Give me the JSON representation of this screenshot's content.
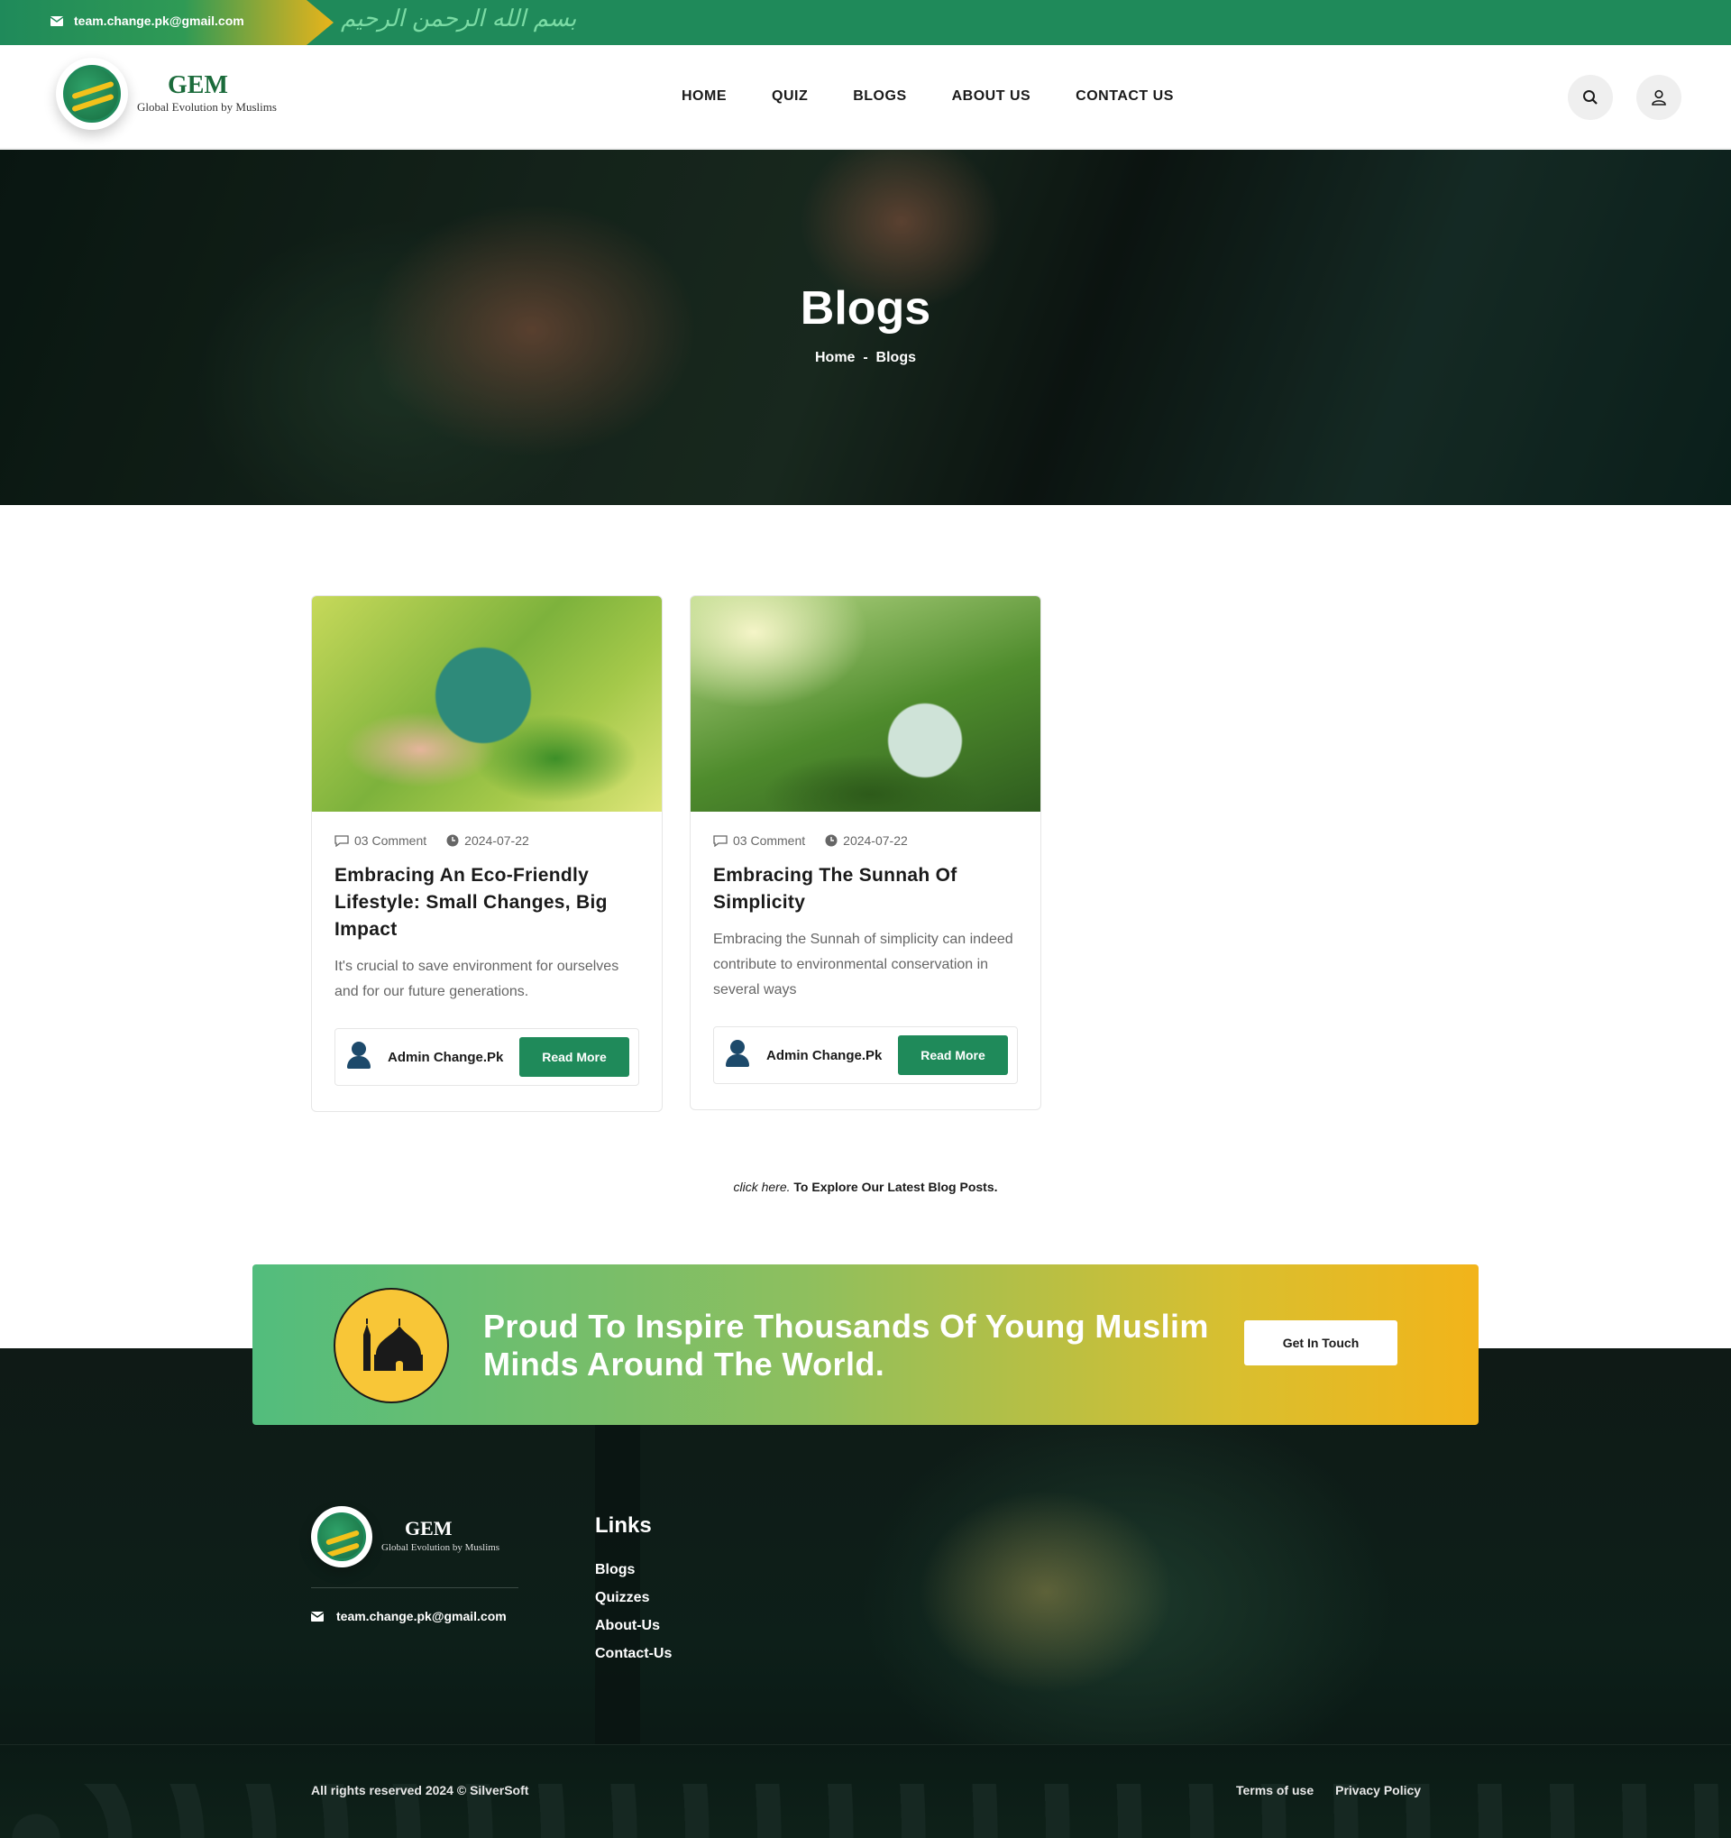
{
  "topbar": {
    "email": "team.change.pk@gmail.com",
    "bismillah": "بسم الله الرحمن الرحيم"
  },
  "brand": {
    "name": "GEM",
    "tagline": "Global Evolution by Muslims"
  },
  "nav": {
    "items": [
      "HOME",
      "QUIZ",
      "BLOGS",
      "ABOUT US",
      "CONTACT US"
    ]
  },
  "header_icons": [
    "search-icon",
    "user-icon"
  ],
  "hero": {
    "title": "Blogs",
    "breadcrumb_home": "Home",
    "breadcrumb_sep": "-",
    "breadcrumb_current": "Blogs"
  },
  "posts": [
    {
      "comments": "03 Comment",
      "date": "2024-07-22",
      "title": "Embracing An Eco-Friendly Lifestyle: Small Changes, Big Impact",
      "excerpt": "It's crucial to save environment for ourselves and for our future generations.",
      "author": "Admin Change.Pk",
      "button": "Read More"
    },
    {
      "comments": "03 Comment",
      "date": "2024-07-22",
      "title": "Embracing The Sunnah Of Simplicity",
      "excerpt": "Embracing the Sunnah of simplicity can indeed contribute to environmental conservation in several ways",
      "author": "Admin Change.Pk",
      "button": "Read More"
    }
  ],
  "explore": {
    "link": "click here.",
    "text": " To Explore Our Latest Blog Posts."
  },
  "cta": {
    "headline": "Proud To Inspire Thousands Of Young Muslim Minds Around The World.",
    "button": "Get In Touch"
  },
  "footer": {
    "email": "team.change.pk@gmail.com",
    "links_title": "Links",
    "links": [
      "Blogs",
      "Quizzes",
      "About-Us",
      "Contact-Us"
    ],
    "copyright": "All rights reserved 2024 © SilverSoft",
    "legal": [
      "Terms of use",
      "Privacy Policy"
    ]
  },
  "colors": {
    "primary_green": "#1f8a5a",
    "accent_gold": "#f2b41a",
    "footer_dark": "#0d1f19"
  }
}
